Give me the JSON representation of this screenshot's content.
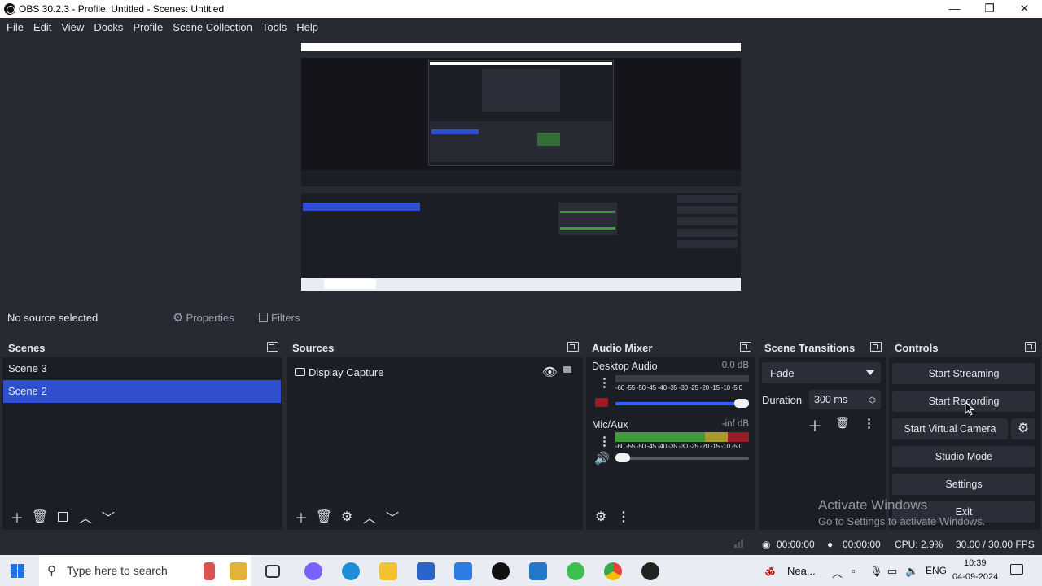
{
  "window": {
    "title": "OBS 30.2.3 - Profile: Untitled - Scenes: Untitled",
    "controls": [
      "—",
      "❐",
      "✕"
    ]
  },
  "menu": [
    "File",
    "Edit",
    "View",
    "Docks",
    "Profile",
    "Scene Collection",
    "Tools",
    "Help"
  ],
  "context_bar": {
    "no_source": "No source selected",
    "properties": "Properties",
    "filters": "Filters"
  },
  "scenes": {
    "title": "Scenes",
    "items": [
      "Scene 3",
      "Scene 2"
    ],
    "selected": "Scene 2"
  },
  "sources": {
    "title": "Sources",
    "items": [
      "Display Capture"
    ]
  },
  "mixer": {
    "title": "Audio Mixer",
    "scale": "-60 -55 -50 -45 -40 -35 -30 -25 -20 -15 -10 -5 0",
    "channels": [
      {
        "name": "Desktop Audio",
        "db": "0.0 dB",
        "muted": true,
        "level_fraction": 0,
        "volume_fraction": 1.0
      },
      {
        "name": "Mic/Aux",
        "db": "-inf dB",
        "muted": false,
        "level_fraction": 0.0,
        "volume_fraction": 0.0
      }
    ]
  },
  "transitions": {
    "title": "Scene Transitions",
    "selected": "Fade",
    "duration_label": "Duration",
    "duration_value": "300 ms"
  },
  "controls": {
    "title": "Controls",
    "start_streaming": "Start Streaming",
    "start_recording": "Start Recording",
    "start_virtual_camera": "Start Virtual Camera",
    "studio_mode": "Studio Mode",
    "settings": "Settings",
    "exit": "Exit"
  },
  "status": {
    "stream_time": "00:00:00",
    "record_time": "00:00:00",
    "cpu": "CPU: 2.9%",
    "fps": "30.00 / 30.00 FPS"
  },
  "watermark": {
    "line1": "Activate Windows",
    "line2": "Go to Settings to activate Windows."
  },
  "taskbar": {
    "search_placeholder": "Type here to search",
    "weather": "Nea...",
    "language": "ENG",
    "time": "10:39",
    "date": "04-09-2024"
  },
  "colors": {
    "selected": "#2f4fd1",
    "panel": "#1c1e25",
    "header": "#272a33",
    "button": "#2b2e38",
    "meter_green": "#3d9c3a",
    "meter_red": "#9b1b25"
  }
}
